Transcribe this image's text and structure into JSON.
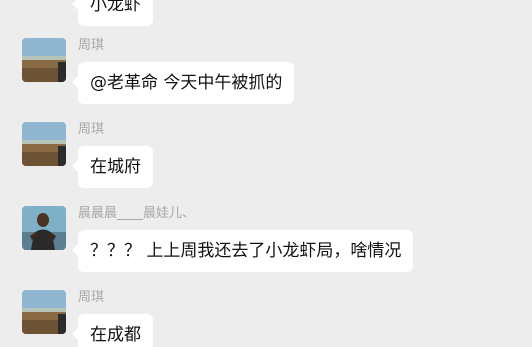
{
  "messages": [
    {
      "sender": "",
      "text": "小龙虾",
      "avatar": "landscape"
    },
    {
      "sender": "周琪",
      "text": "@老革命 今天中午被抓的",
      "avatar": "landscape"
    },
    {
      "sender": "周琪",
      "text": "在城府",
      "avatar": "landscape"
    },
    {
      "sender": "晨晨晨____晨娃儿、",
      "text": "？？？ 上上周我还去了小龙虾局，啥情况",
      "avatar": "person"
    },
    {
      "sender": "周琪",
      "text": "在成都",
      "avatar": "landscape"
    }
  ]
}
